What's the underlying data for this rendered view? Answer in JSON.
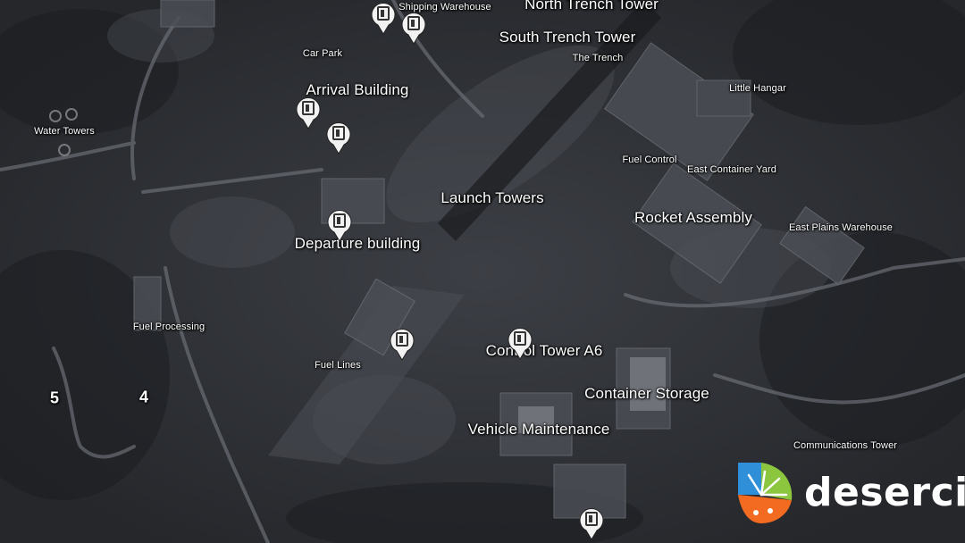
{
  "map": {
    "labels_small": [
      {
        "text": "Shipping Warehouse"
      },
      {
        "text": "Car Park"
      },
      {
        "text": "The Trench"
      },
      {
        "text": "Little Hangar"
      },
      {
        "text": "Water Towers"
      },
      {
        "text": "Fuel Control"
      },
      {
        "text": "East Container Yard"
      },
      {
        "text": "East Plains Warehouse"
      },
      {
        "text": "Fuel Processing"
      },
      {
        "text": "Fuel Lines"
      },
      {
        "text": "Communications Tower"
      }
    ],
    "labels_large": [
      {
        "text": "North Trench Tower"
      },
      {
        "text": "South Trench Tower"
      },
      {
        "text": "Arrival Building"
      },
      {
        "text": "Launch Towers"
      },
      {
        "text": "Rocket Assembly"
      },
      {
        "text": "Departure building"
      },
      {
        "text": "Control Tower A6"
      },
      {
        "text": "Container Storage"
      },
      {
        "text": "Vehicle Maintenance"
      }
    ],
    "numbers": [
      {
        "text": "5"
      },
      {
        "text": "4"
      }
    ],
    "pins": [
      {
        "icon": "door-icon"
      },
      {
        "icon": "door-icon"
      },
      {
        "icon": "door-icon"
      },
      {
        "icon": "door-icon"
      },
      {
        "icon": "door-icon"
      },
      {
        "icon": "door-icon"
      },
      {
        "icon": "door-icon"
      },
      {
        "icon": "door-icon"
      }
    ]
  },
  "logo": {
    "text": "desercik"
  },
  "colors": {
    "terrain": "#2a2c30",
    "label": "#ffffff",
    "pin": "#f2f2f2",
    "logo_blue": "#2f8fd8",
    "logo_green": "#8cc63f",
    "logo_orange": "#f26b21"
  }
}
